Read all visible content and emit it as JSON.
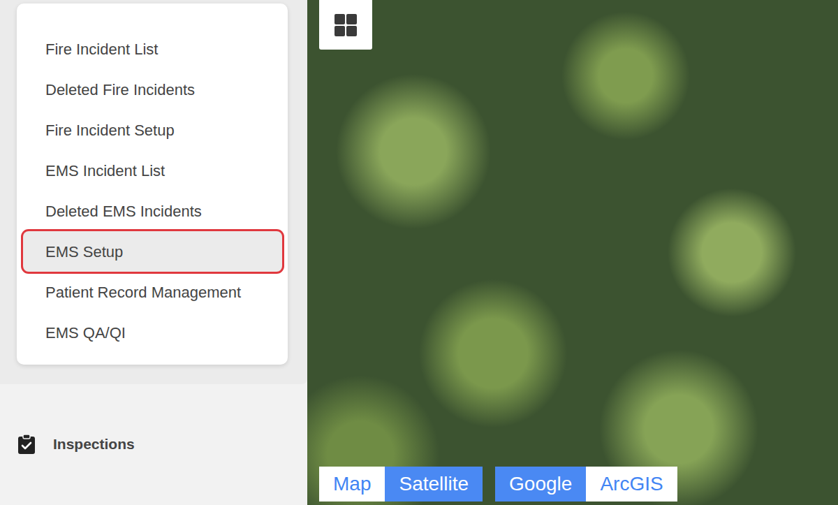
{
  "menu": {
    "items": [
      {
        "label": "Fire Incident List",
        "selected": false
      },
      {
        "label": "Deleted Fire Incidents",
        "selected": false
      },
      {
        "label": "Fire Incident Setup",
        "selected": false
      },
      {
        "label": "EMS Incident List",
        "selected": false
      },
      {
        "label": "Deleted EMS Incidents",
        "selected": false
      },
      {
        "label": "EMS Setup",
        "selected": true
      },
      {
        "label": "Patient Record Management",
        "selected": false
      },
      {
        "label": "EMS QA/QI",
        "selected": false
      }
    ]
  },
  "sidebar": {
    "items": [
      {
        "label": "Inspections"
      }
    ]
  },
  "map": {
    "type_toggle": [
      {
        "label": "Map",
        "selected": false
      },
      {
        "label": "Satellite",
        "selected": true
      }
    ],
    "provider_toggle": [
      {
        "label": "Google",
        "selected": true
      },
      {
        "label": "ArcGIS",
        "selected": false
      }
    ]
  }
}
